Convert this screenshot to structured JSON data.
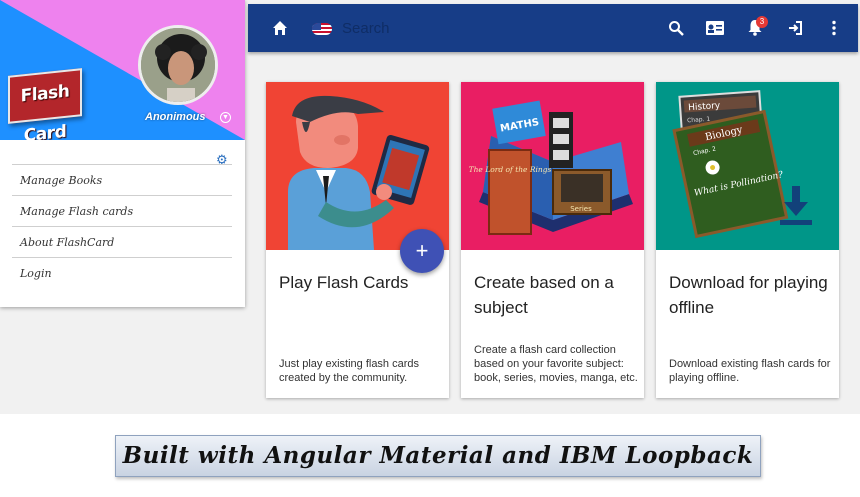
{
  "sidebar": {
    "logo": "Flash Card",
    "user_name": "Anonimous",
    "items": [
      {
        "label": "Manage Books"
      },
      {
        "label": "Manage Flash cards"
      },
      {
        "label": "About FlashCard"
      },
      {
        "label": "Login"
      }
    ]
  },
  "toolbar": {
    "search_placeholder": "Search",
    "notification_count": "3"
  },
  "cards": [
    {
      "title": "Play Flash Cards",
      "description": "Just play existing flash cards created by the community."
    },
    {
      "title": "Create based on a subject",
      "description": "Create a flash card collection based on your favorite subject: book, series, movies, manga, etc."
    },
    {
      "title": "Download for playing offline",
      "description": "Download existing flash cards for playing offline."
    }
  ],
  "illustrations": {
    "book_maths": "MATHS",
    "book_lotr": "The Lord of the Rings",
    "book_series": "Series",
    "history": "History",
    "biology": "Biology",
    "chap1": "Chap. 1",
    "chap2": "Chap. 2",
    "pollination": "What is Pollination?"
  },
  "banner": "Built with Angular Material and IBM Loopback",
  "colors": {
    "toolbar": "#173d87",
    "card1": "#f04434",
    "card2": "#e91e63",
    "card3": "#009688",
    "fab": "#3f51b5"
  }
}
